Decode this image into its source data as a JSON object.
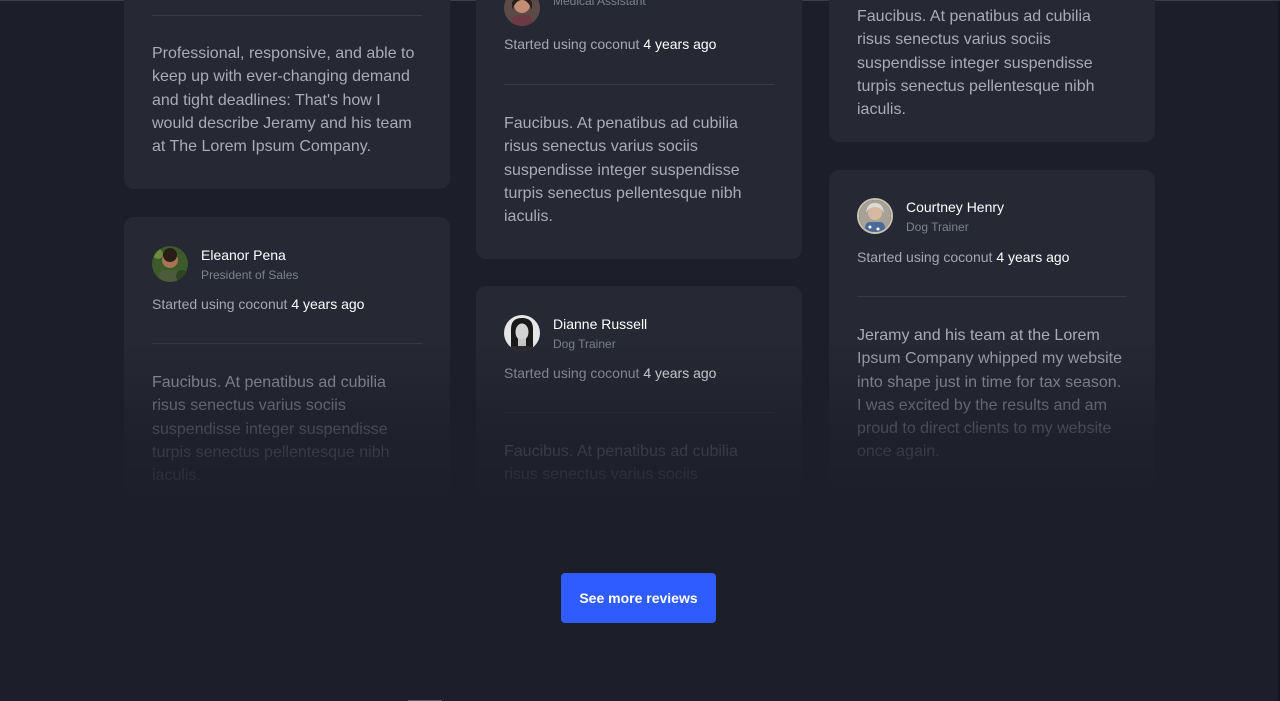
{
  "started_prefix": "Started using coconut",
  "started_ago": "4 years ago",
  "cta_label": "See more reviews",
  "reviews": [
    {
      "quote": "Professional, responsive, and able to keep up with ever-changing demand and tight deadlines: That's how I would describe Jeramy and his team at The Lorem Ipsum Company."
    },
    {
      "name": "Eleanor Pena",
      "role": "President of Sales",
      "quote": "Faucibus. At penatibus ad cubilia risus senectus varius sociis suspendisse integer suspendisse turpis senectus pellentesque nibh iaculis."
    },
    {
      "role": "Medical Assistant",
      "quote": "Faucibus. At penatibus ad cubilia risus senectus varius sociis suspendisse integer suspendisse turpis senectus pellentesque nibh iaculis."
    },
    {
      "name": "Dianne Russell",
      "role": "Dog Trainer",
      "quote": "Faucibus. At penatibus ad cubilia risus senectus varius sociis"
    },
    {
      "quote": "Faucibus. At penatibus ad cubilia risus senectus varius sociis suspendisse integer suspendisse turpis senectus pellentesque nibh iaculis."
    },
    {
      "name": "Courtney Henry",
      "role": "Dog Trainer",
      "quote": "Jeramy and his team at the Lorem Ipsum Company whipped my website into shape just in time for tax season. I was excited by the results and am proud to direct clients to my website once again."
    }
  ]
}
